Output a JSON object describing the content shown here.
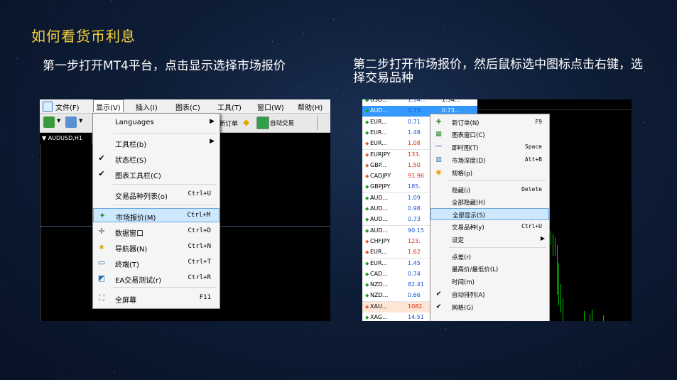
{
  "slide": {
    "title": "如何看货币利息",
    "step1": "第一步打开MT4平台，点击显示选择市场报价",
    "step2": "第二步打开市场报价，然后鼠标选中图标点击右键，选择交易品种"
  },
  "shot1": {
    "menubar": [
      "文件(F)",
      "显示(V)",
      "插入(I)",
      "图表(C)",
      "工具(T)",
      "窗口(W)",
      "帮助(H)"
    ],
    "toolbar": {
      "order_label": "新订单",
      "auto_trade_label": "自动交易"
    },
    "chart_tab": "▼ AUDUSD,H1",
    "view_menu": [
      {
        "label": "Languages",
        "shortcut": "",
        "submenu": true,
        "icon": "",
        "check": false
      },
      {
        "label": "工具栏(b)",
        "shortcut": "",
        "submenu": true,
        "icon": "",
        "check": false
      },
      {
        "label": "状态栏(S)",
        "shortcut": "",
        "submenu": false,
        "icon": "",
        "check": true
      },
      {
        "label": "图表工具栏(C)",
        "shortcut": "",
        "submenu": false,
        "icon": "",
        "check": true
      },
      {
        "label": "交易品种列表(o)",
        "shortcut": "Ctrl+U",
        "submenu": false,
        "icon": "",
        "check": false
      },
      {
        "label": "市场报价(M)",
        "shortcut": "Ctrl+M",
        "submenu": false,
        "icon": "market-watch-icon",
        "check": false,
        "highlight": true
      },
      {
        "label": "数据窗口",
        "shortcut": "Ctrl+D",
        "submenu": false,
        "icon": "crosshair-icon",
        "check": false
      },
      {
        "label": "导航器(N)",
        "shortcut": "Ctrl+N",
        "submenu": false,
        "icon": "folder-star-icon",
        "check": false
      },
      {
        "label": "终端(T)",
        "shortcut": "Ctrl+T",
        "submenu": false,
        "icon": "terminal-icon",
        "check": false
      },
      {
        "label": "EA交易测试(r)",
        "shortcut": "Ctrl+R",
        "submenu": false,
        "icon": "tester-icon",
        "check": false
      },
      {
        "label": "全屏幕",
        "shortcut": "F11",
        "submenu": false,
        "icon": "fullscreen-icon",
        "check": false
      }
    ]
  },
  "shot2": {
    "market_watch": [
      {
        "symbol": "USD...",
        "bid": "1.34...",
        "ask": "1.34...",
        "dir": "up",
        "bg": "#ffffff"
      },
      {
        "symbol": "AUD...",
        "bid": "0.73...",
        "ask": "0.73...",
        "dir": "up",
        "bg": "sel"
      },
      {
        "symbol": "EUR...",
        "bid": "0.71",
        "ask": "",
        "dir": "up",
        "bg": "#ffffff"
      },
      {
        "symbol": "EUR...",
        "bid": "1.48",
        "ask": "",
        "dir": "up",
        "bg": "#ffffff"
      },
      {
        "symbol": "EUR...",
        "bid": "1.08",
        "ask": "",
        "dir": "down",
        "bg": "#ffffff"
      },
      {
        "symbol": "EURJPY",
        "bid": "133.",
        "ask": "",
        "dir": "down",
        "bg": "#ffffff"
      },
      {
        "symbol": "GBP...",
        "bid": "1.50",
        "ask": "",
        "dir": "down",
        "bg": "#ffffff"
      },
      {
        "symbol": "CADJPY",
        "bid": "91.96",
        "ask": "",
        "dir": "down",
        "bg": "#ffffff"
      },
      {
        "symbol": "GBPJPY",
        "bid": "185.",
        "ask": "",
        "dir": "up",
        "bg": "#ffffff"
      },
      {
        "symbol": "AUD...",
        "bid": "1.09",
        "ask": "",
        "dir": "up",
        "bg": "#ffffff"
      },
      {
        "symbol": "AUD...",
        "bid": "0.98",
        "ask": "",
        "dir": "up",
        "bg": "#ffffff"
      },
      {
        "symbol": "AUD...",
        "bid": "0.73",
        "ask": "",
        "dir": "up",
        "bg": "#ffffff"
      },
      {
        "symbol": "AUD...",
        "bid": "90.15",
        "ask": "",
        "dir": "up",
        "bg": "#ffffff"
      },
      {
        "symbol": "CHFJPY",
        "bid": "123.",
        "ask": "",
        "dir": "down",
        "bg": "#ffffff"
      },
      {
        "symbol": "EUR...",
        "bid": "1.62",
        "ask": "",
        "dir": "down",
        "bg": "#ffffff"
      },
      {
        "symbol": "EUR...",
        "bid": "1.45",
        "ask": "",
        "dir": "up",
        "bg": "#ffffff"
      },
      {
        "symbol": "CAD...",
        "bid": "0.74",
        "ask": "",
        "dir": "up",
        "bg": "#ffffff"
      },
      {
        "symbol": "NZD...",
        "bid": "82.41",
        "ask": "",
        "dir": "up",
        "bg": "#ffffff"
      },
      {
        "symbol": "NZD...",
        "bid": "0.66",
        "ask": "",
        "dir": "up",
        "bg": "#ffffff"
      },
      {
        "symbol": "XAU...",
        "bid": "1082.",
        "ask": "",
        "dir": "down",
        "bg": "#fde6d6"
      },
      {
        "symbol": "XAG...",
        "bid": "14.51",
        "ask": "",
        "dir": "up",
        "bg": "#ffffff"
      }
    ],
    "context_menu": [
      {
        "label": "新订单(N)",
        "shortcut": "F9",
        "icon": "new-order-icon",
        "check": false
      },
      {
        "label": "图表窗口(C)",
        "shortcut": "",
        "icon": "chart-window-icon",
        "check": false
      },
      {
        "label": "即时图(T)",
        "shortcut": "Space",
        "icon": "tick-chart-icon",
        "check": false
      },
      {
        "label": "市场深度(D)",
        "shortcut": "Alt+B",
        "icon": "depth-icon",
        "check": false
      },
      {
        "label": "规格(p)",
        "shortcut": "",
        "icon": "spec-icon",
        "check": false
      },
      {
        "label": "隐藏(i)",
        "shortcut": "Delete",
        "icon": "",
        "check": false
      },
      {
        "label": "全部隐藏(H)",
        "shortcut": "",
        "icon": "",
        "check": false
      },
      {
        "label": "全部显示(S)",
        "shortcut": "",
        "icon": "",
        "check": false,
        "highlight": true
      },
      {
        "label": "交易品种(y)",
        "shortcut": "Ctrl+U",
        "icon": "",
        "check": false
      },
      {
        "label": "设定",
        "shortcut": "",
        "icon": "",
        "check": false,
        "submenu": true
      },
      {
        "label": "点差(r)",
        "shortcut": "",
        "icon": "",
        "check": false
      },
      {
        "label": "最高价/最低价(L)",
        "shortcut": "",
        "icon": "",
        "check": false
      },
      {
        "label": "时间(m)",
        "shortcut": "",
        "icon": "",
        "check": false
      },
      {
        "label": "自动排列(A)",
        "shortcut": "",
        "icon": "",
        "check": true
      },
      {
        "label": "网格(G)",
        "shortcut": "",
        "icon": "",
        "check": true
      }
    ]
  },
  "colors": {
    "title": "#f5d23a",
    "up": "#1aa31a",
    "down": "#e0602a",
    "highlight": "#cce8ff"
  }
}
